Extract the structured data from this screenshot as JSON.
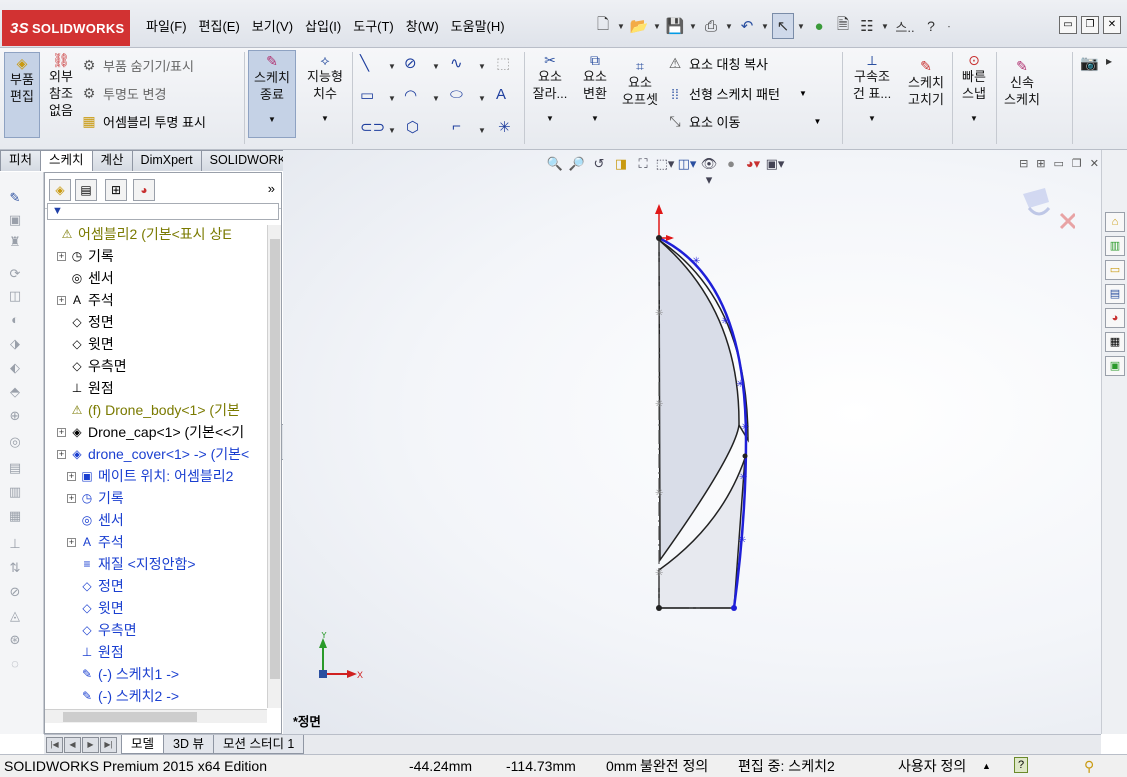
{
  "app": {
    "brand": "SOLIDWORKS",
    "brand_mark": "3S"
  },
  "menu": [
    "파일(F)",
    "편집(E)",
    "보기(V)",
    "삽입(I)",
    "도구(T)",
    "창(W)",
    "도움말(H)"
  ],
  "quickbar": {
    "search_trunc": "스..",
    "help": "?",
    "more": "▸"
  },
  "ribbon": {
    "edit_part": "부품\n편집",
    "no_external_ref": "외부\n참조\n없음",
    "hide_show_parts": "부품 숨기기/표시",
    "change_transparency": "투명도 변경",
    "assembly_transparency": "어셈블리 투명 표시",
    "exit_sketch": "스케치\n종료",
    "smart_dimension": "지능형\n치수",
    "trim": "요소\n잘라...",
    "convert": "요소\n변환",
    "offset": "요소\n오프셋",
    "mirror": "요소 대칭 복사",
    "linear_pattern": "선형 스케치 패턴",
    "move": "요소 이동",
    "relations": "구속조\n건 표...",
    "repair": "스케치\n고치기",
    "quick_snaps": "빠른\n스냅",
    "rapid_sketch": "신속\n스케치"
  },
  "command_tabs": [
    "피처",
    "스케치",
    "계산",
    "DimXpert",
    "SOLIDWORKS 애드인"
  ],
  "active_command_tab": "스케치",
  "tree": [
    {
      "label": "어셈블리2  (기본<표시 상E",
      "icon": "⚠",
      "style": "olive",
      "indent": 0,
      "expand": false
    },
    {
      "label": "기록",
      "icon": "◷",
      "style": "",
      "indent": 1,
      "expand": true
    },
    {
      "label": "센서",
      "icon": "◎",
      "style": "",
      "indent": 1,
      "expand": false
    },
    {
      "label": "주석",
      "icon": "A",
      "style": "",
      "indent": 1,
      "expand": true
    },
    {
      "label": "정면",
      "icon": "◇",
      "style": "",
      "indent": 1,
      "expand": false
    },
    {
      "label": "윗면",
      "icon": "◇",
      "style": "",
      "indent": 1,
      "expand": false
    },
    {
      "label": "우측면",
      "icon": "◇",
      "style": "",
      "indent": 1,
      "expand": false
    },
    {
      "label": "원점",
      "icon": "⊥",
      "style": "",
      "indent": 1,
      "expand": false
    },
    {
      "label": "(f) Drone_body<1> (기본",
      "icon": "⚠",
      "style": "olive",
      "indent": 1,
      "expand": false
    },
    {
      "label": "Drone_cap<1> (기본<<기",
      "icon": "◈",
      "style": "",
      "indent": 1,
      "expand": true
    },
    {
      "label": "drone_cover<1> -> (기본<",
      "icon": "◈",
      "style": "blue",
      "indent": 1,
      "expand": true
    },
    {
      "label": "메이트 위치: 어셈블리2",
      "icon": "▣",
      "style": "blue",
      "indent": 2,
      "expand": true
    },
    {
      "label": "기록",
      "icon": "◷",
      "style": "blue",
      "indent": 2,
      "expand": true
    },
    {
      "label": "센서",
      "icon": "◎",
      "style": "blue",
      "indent": 2,
      "expand": false
    },
    {
      "label": "주석",
      "icon": "A",
      "style": "blue",
      "indent": 2,
      "expand": true
    },
    {
      "label": "재질 <지정안함>",
      "icon": "≡",
      "style": "blue",
      "indent": 2,
      "expand": false
    },
    {
      "label": "정면",
      "icon": "◇",
      "style": "blue",
      "indent": 2,
      "expand": false
    },
    {
      "label": "윗면",
      "icon": "◇",
      "style": "blue",
      "indent": 2,
      "expand": false
    },
    {
      "label": "우측면",
      "icon": "◇",
      "style": "blue",
      "indent": 2,
      "expand": false
    },
    {
      "label": "원점",
      "icon": "⊥",
      "style": "blue",
      "indent": 2,
      "expand": false
    },
    {
      "label": "(-) 스케치1 ->",
      "icon": "✎",
      "style": "blue",
      "indent": 2,
      "expand": false
    },
    {
      "label": "(-) 스케치2 ->",
      "icon": "✎",
      "style": "blue",
      "indent": 2,
      "expand": false
    }
  ],
  "viewport": {
    "view_name": "*정면",
    "triad_x": "X",
    "triad_y": "Y"
  },
  "bottom_tabs": [
    "모델",
    "3D 뷰",
    "모션 스터디 1"
  ],
  "active_bottom_tab": "모델",
  "status": {
    "edition": "SOLIDWORKS Premium 2015 x64 Edition",
    "x_coord": "-44.24mm",
    "y_coord": "-114.73mm",
    "z_coord": "0mm",
    "definition": "불완전 정의",
    "editing": "편집 중: 스케치2",
    "units": "사용자 정의"
  },
  "colors": {
    "brand_red": "#d23232",
    "sketch_blue": "#1f1fd8",
    "axis_red": "#e01818",
    "tree_olive": "#7a7a00",
    "tree_blue": "#1a3fd0"
  }
}
